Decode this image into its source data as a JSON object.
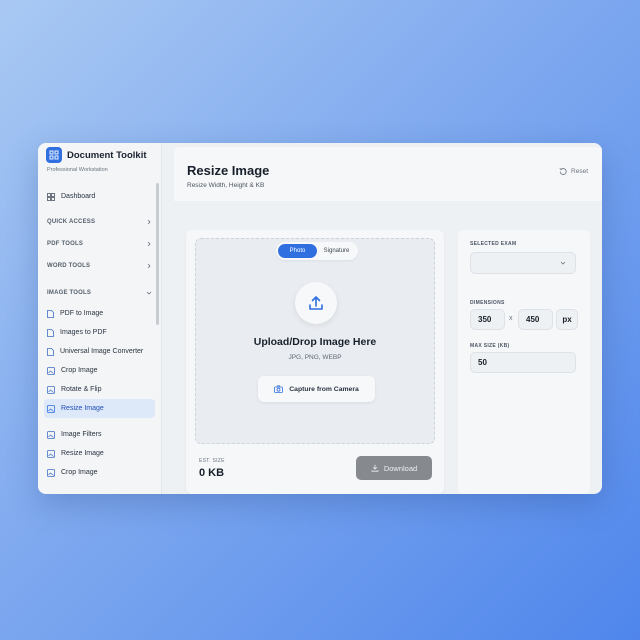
{
  "app": {
    "title": "Document Toolkit",
    "subtitle": "Professional Workstation"
  },
  "sidebar": {
    "dashboard": "Dashboard",
    "sections": {
      "quick_access": "QUICK ACCESS",
      "pdf_tools": "PDF TOOLS",
      "word_tools": "WORD TOOLS",
      "image_tools": "IMAGE TOOLS"
    },
    "image_items": [
      "PDF to Image",
      "Images to PDF",
      "Universal Image Converter",
      "Crop Image",
      "Rotate & Flip",
      "Resize Image",
      "Image Filters",
      "Resize Image",
      "Crop Image"
    ],
    "active_item": "Resize Image"
  },
  "header": {
    "title": "Resize Image",
    "subtitle": "Resize Width, Height & KB",
    "reset_label": "Reset"
  },
  "upload": {
    "tabs": [
      "Photo",
      "Signature"
    ],
    "active_tab": "Photo",
    "title": "Upload/Drop Image Here",
    "formats": "JPG, PNG, WEBP",
    "camera_label": "Capture from Camera"
  },
  "footer": {
    "est_label": "EST. SIZE",
    "est_value": "0 KB",
    "download_label": "Download"
  },
  "settings": {
    "exam_label": "SELECTED EXAM",
    "exam_value": "",
    "dimensions_label": "DIMENSIONS",
    "width": "350",
    "separator": "x",
    "height": "450",
    "unit": "px",
    "max_size_label": "MAX SIZE (KB)",
    "max_size": "50"
  },
  "colors": {
    "accent": "#2f6fe0",
    "download_disabled": "#86898e"
  }
}
